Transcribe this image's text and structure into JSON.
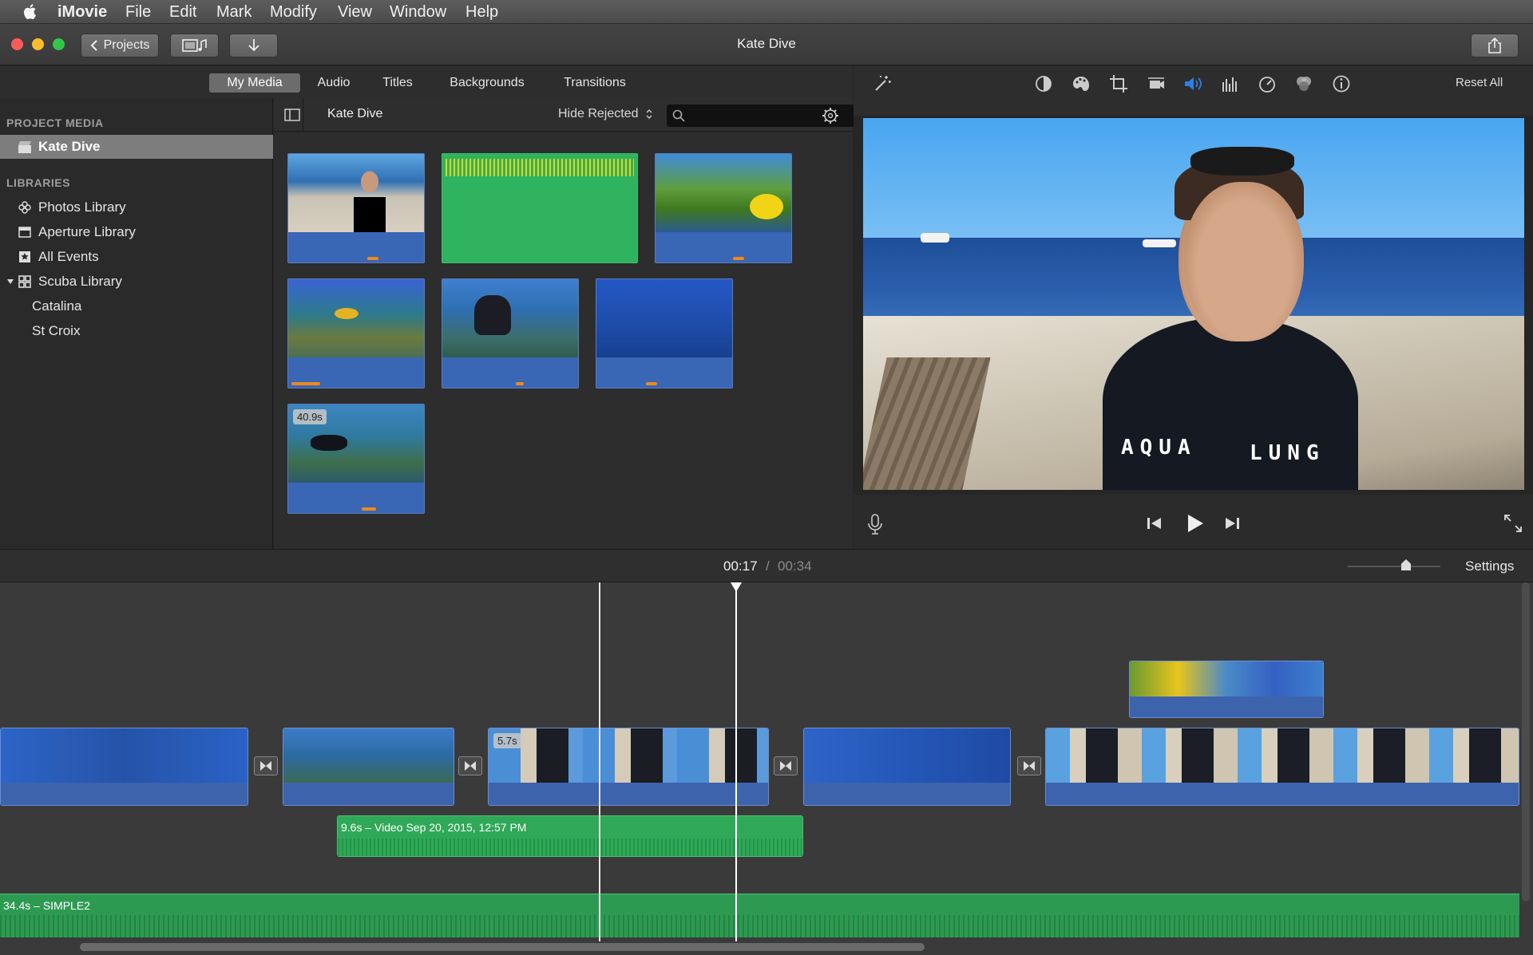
{
  "menubar": {
    "app": "iMovie",
    "items": [
      "File",
      "Edit",
      "Mark",
      "Modify",
      "View",
      "Window",
      "Help"
    ]
  },
  "titlebar": {
    "projects_label": "Projects",
    "title": "Kate Dive"
  },
  "browser_tabs": [
    "My Media",
    "Audio",
    "Titles",
    "Backgrounds",
    "Transitions"
  ],
  "sidebar": {
    "project_media_heading": "PROJECT MEDIA",
    "project_item": "Kate Dive",
    "libraries_heading": "LIBRARIES",
    "libraries": [
      "Photos Library",
      "Aperture Library",
      "All Events",
      "Scuba Library"
    ],
    "sub_events": [
      "Catalina",
      "St Croix"
    ]
  },
  "browser_header": {
    "event_title": "Kate Dive",
    "filter": "Hide Rejected"
  },
  "browser_clips": {
    "badge": "40.9s"
  },
  "viewer": {
    "reset_label": "Reset All",
    "overlay_text_1": "AQUA",
    "overlay_text_2": "LUNG"
  },
  "timeline": {
    "current_time": "00:17",
    "separator": "/",
    "total_time": "00:34",
    "settings_label": "Settings",
    "clip_badge": "5.7s",
    "cutaway_label": "9.6s – Video Sep 20, 2015, 12:57 PM",
    "music_label": "34.4s – SIMPLE2"
  },
  "colors": {
    "accent_blue": "#3d63ad",
    "audio_green": "#2fa957",
    "playhead": "#ffffff"
  }
}
